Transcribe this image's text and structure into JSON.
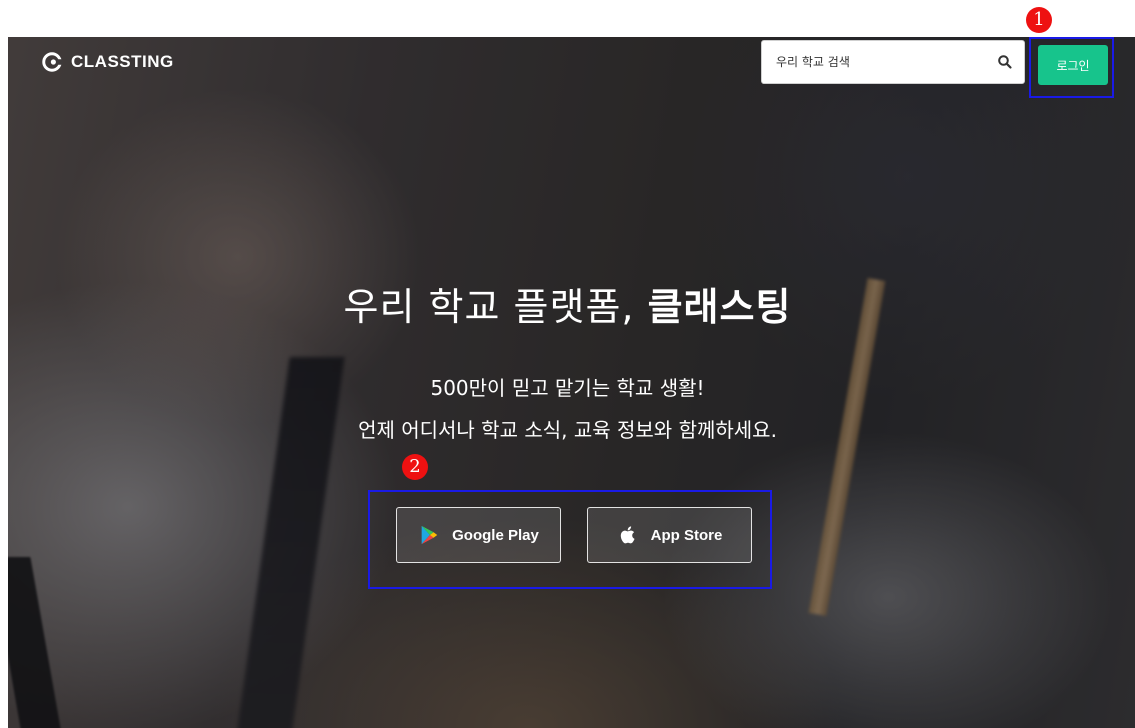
{
  "header": {
    "logo_text": "CLASSTING",
    "search": {
      "placeholder": "우리 학교 검색"
    },
    "login_label": "로그인"
  },
  "hero": {
    "headline_light": "우리 학교 플랫폼, ",
    "headline_bold": "클래스팅",
    "subline_1": "500만이 믿고 맡기는 학교 생활!",
    "subline_2": "언제 어디서나 학교 소식, 교육 정보와 함께하세요."
  },
  "store_buttons": {
    "google_label": "Google Play",
    "apple_label": "App Store"
  },
  "annotations": {
    "badge_1": "1",
    "badge_2": "2",
    "box_color": "#1a1ae6",
    "badge_color": "#ee1111"
  },
  "colors": {
    "accent": "#17c48c"
  },
  "icons": {
    "logo": "classting-logo-icon",
    "search": "search-icon",
    "google": "google-play-icon",
    "apple": "apple-icon"
  }
}
